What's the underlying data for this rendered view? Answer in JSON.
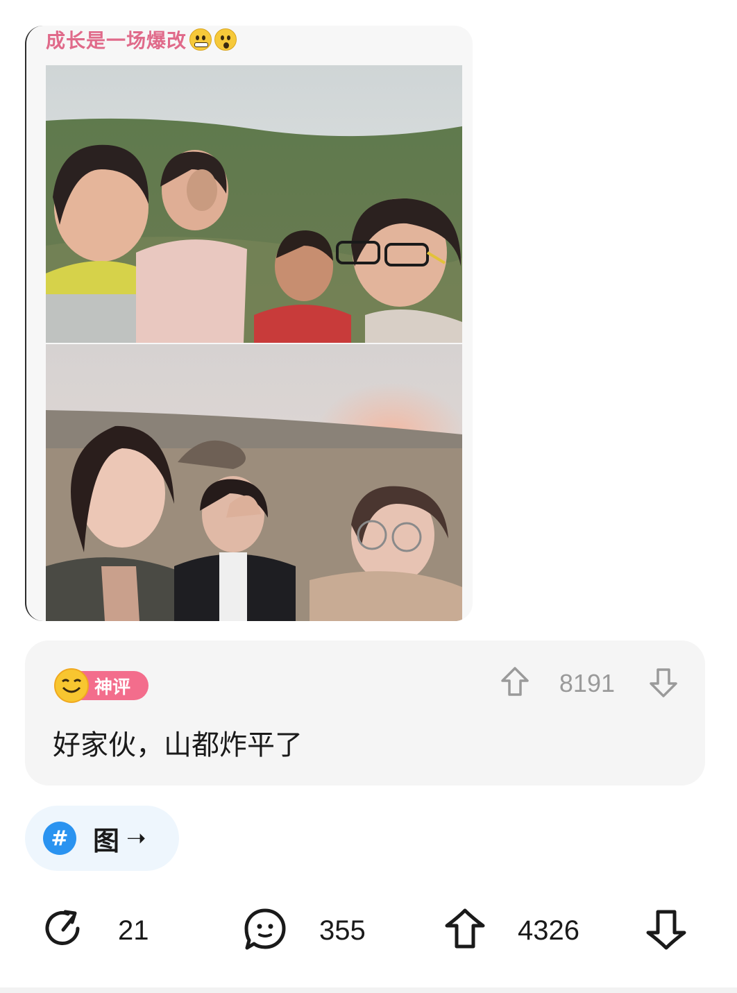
{
  "post": {
    "image_caption": "成长是一场爆改",
    "caption_emojis": [
      "grimacing-face-emoji",
      "hushed-face-emoji"
    ]
  },
  "comment": {
    "badge_label": "神评",
    "upvotes": "8191",
    "text": "好家伙，山都炸平了"
  },
  "topic": {
    "hash_symbol": "#",
    "label": "图",
    "arrow": "➝"
  },
  "actions": {
    "shares": "21",
    "comments": "355",
    "upvotes": "4326"
  },
  "colors": {
    "caption": "#e06a8a",
    "badge_pink": "#f36d8c",
    "topic_blue": "#2a93f0",
    "card_bg": "#f5f5f5"
  }
}
